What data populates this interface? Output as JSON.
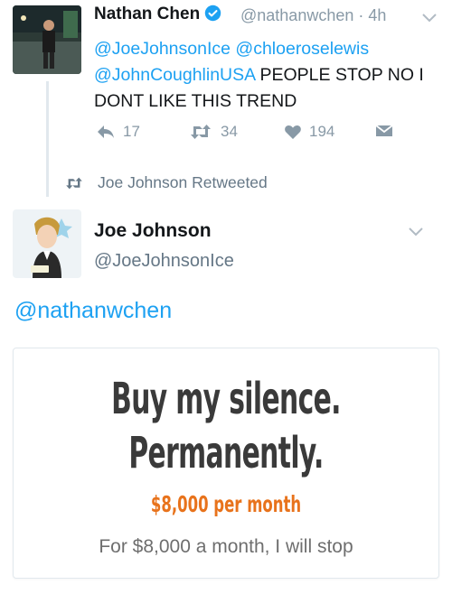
{
  "reply_tweet": {
    "author_name": "Nathan Chen",
    "handle": "@nathanwchen",
    "separator": "·",
    "time": "4h",
    "mentions": [
      "@JoeJohnsonIce",
      "@chloeroselewis",
      "@JohnCoughlinUSA"
    ],
    "text": "PEOPLE STOP NO I DONT LIKE THIS TREND",
    "reply_count": "17",
    "retweet_count": "34",
    "like_count": "194",
    "verified": true
  },
  "retweet_context": {
    "label": "Joe Johnson Retweeted"
  },
  "retweeted_tweet": {
    "author_name": "Joe Johnson",
    "handle": "@JoeJohnsonIce",
    "text": "@nathanwchen",
    "card": {
      "headline_1": "Buy my silence.",
      "headline_2": "Permanently.",
      "price": "$8,000 per month",
      "caption": "For $8,000 a month, I will stop"
    }
  },
  "icons": [
    "verified-badge-icon",
    "chevron-down-icon",
    "reply-icon",
    "retweet-icon",
    "like-icon",
    "dm-icon",
    "retweeted-icon"
  ],
  "colors": {
    "link": "#1da1f2",
    "muted": "#8899a6",
    "verified": "#1da1f2",
    "price": "#e8731c"
  }
}
